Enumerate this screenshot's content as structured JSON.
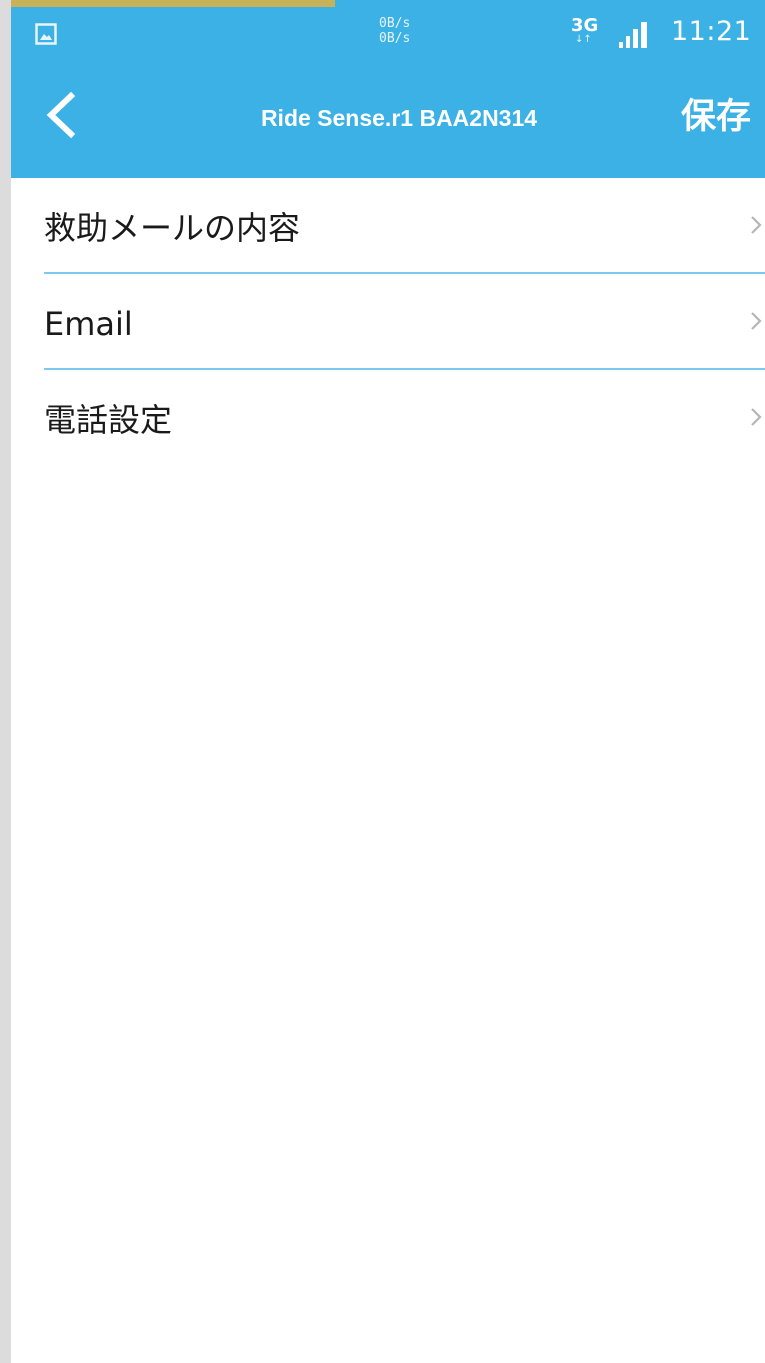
{
  "status_bar": {
    "net_speed_up": "0B/s",
    "net_speed_down": "0B/s",
    "network_type": "3G",
    "network_arrows": "↓↑",
    "time": "11:21",
    "gallery_icon": "image-notification-icon",
    "signal_icon": "cell-signal-icon"
  },
  "toolbar": {
    "back_icon": "chevron-left-icon",
    "title": "Ride Sense.r1 BAA2N314",
    "save_label": "保存"
  },
  "settings": {
    "items": [
      {
        "label": "救助メールの内容",
        "icon": "chevron-right-icon"
      },
      {
        "label": "Email",
        "icon": "chevron-right-icon"
      },
      {
        "label": "電話設定",
        "icon": "chevron-right-icon"
      }
    ]
  },
  "colors": {
    "accent": "#3bb1e6",
    "divider": "#7cc9ee",
    "progress_strip": "#c7b25a",
    "side_frame": "#dcdcdc"
  }
}
